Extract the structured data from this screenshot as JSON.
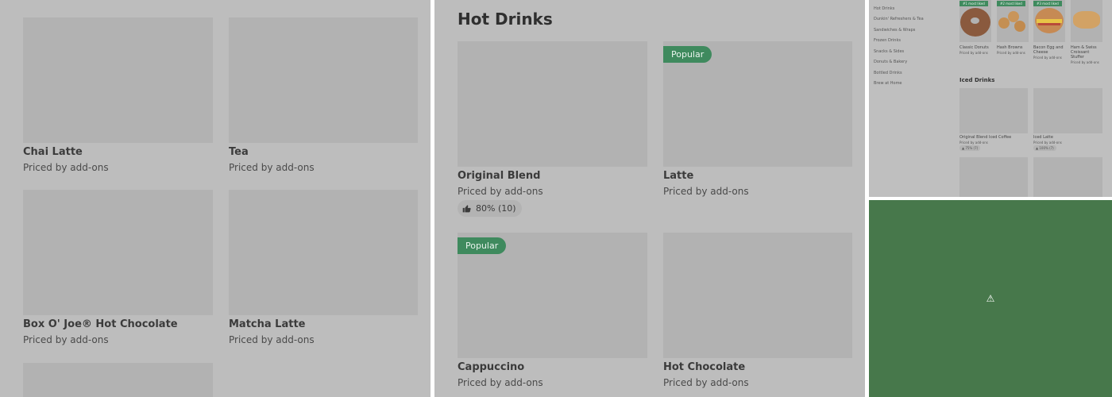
{
  "panel_a": {
    "items": [
      {
        "name": "Chai Latte",
        "price": "Priced by add-ons"
      },
      {
        "name": "Tea",
        "price": "Priced by add-ons"
      },
      {
        "name": "Box O' Joe® Hot Chocolate",
        "price": "Priced by add-ons"
      },
      {
        "name": "Matcha Latte",
        "price": "Priced by add-ons"
      }
    ]
  },
  "panel_b": {
    "section_title": "Hot Drinks",
    "items": [
      {
        "name": "Original Blend",
        "price": "Priced by add-ons",
        "rating": "80% (10)"
      },
      {
        "name": "Latte",
        "price": "Priced by add-ons",
        "badge": "Popular"
      },
      {
        "name": "Cappuccino",
        "price": "Priced by add-ons",
        "badge": "Popular"
      },
      {
        "name": "Hot Chocolate",
        "price": "Priced by add-ons"
      }
    ]
  },
  "panel_c": {
    "sidebar": [
      "Hot Drinks",
      "Dunkin' Refreshers & Tea",
      "Sandwiches & Wraps",
      "Frozen Drinks",
      "Snacks & Sides",
      "Donuts & Bakery",
      "Bottled Drinks",
      "Brew at Home"
    ],
    "top_items": [
      {
        "name": "Classic Donuts",
        "price": "Priced by add-ons",
        "badge": "#1 most liked"
      },
      {
        "name": "Hash Browns",
        "price": "Priced by add-ons",
        "badge": "#2 most liked"
      },
      {
        "name": "Bacon Egg and Cheese",
        "price": "Priced by add-ons",
        "badge": "#3 most liked"
      },
      {
        "name": "Ham & Swiss Croissant Stuffer",
        "price": "Priced by add-ons"
      }
    ],
    "section_title": "Iced Drinks",
    "iced_items": [
      {
        "name": "Original Blend Iced Coffee",
        "price": "Priced by add-ons",
        "rating": "75% (7)"
      },
      {
        "name": "Iced Latte",
        "price": "Priced by add-ons",
        "rating": "100% (7)"
      }
    ]
  },
  "panel_d": {
    "icon": "warning-icon",
    "icon_glyph": "⚠"
  },
  "colors": {
    "overlay_gray": "#bdbdbd",
    "placeholder": "#b2b2b2",
    "badge_green": "#3f8a5e",
    "panel_d_green": "#47784b"
  }
}
